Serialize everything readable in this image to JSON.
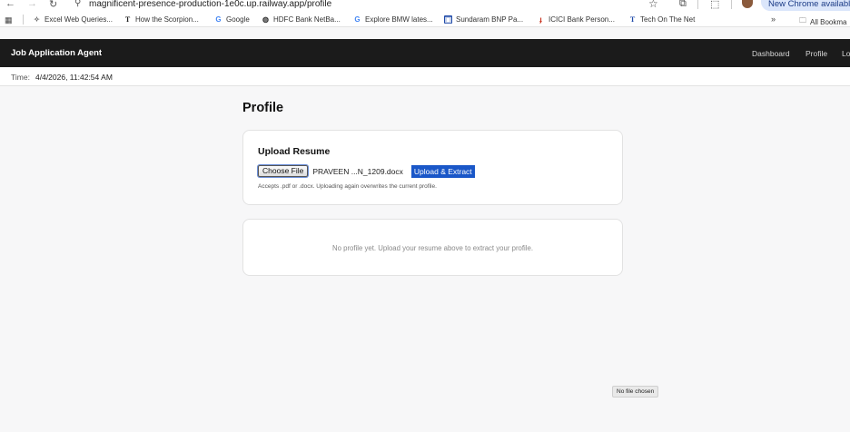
{
  "browser": {
    "url": "magnificent-presence-production-1e0c.up.railway.app/profile",
    "new_chrome_label": "New Chrome available",
    "bookmarks": [
      {
        "label": "Excel Web Queries...",
        "icon": "sparkle-icon"
      },
      {
        "label": "How the Scorpion...",
        "icon": "t-icon"
      },
      {
        "label": "Google",
        "icon": "google-icon"
      },
      {
        "label": "HDFC Bank NetBa...",
        "icon": "globe-icon"
      },
      {
        "label": "Explore BMW lates...",
        "icon": "google-icon"
      },
      {
        "label": "Sundaram BNP Pa...",
        "icon": "bank-icon"
      },
      {
        "label": "ICICI Bank Person...",
        "icon": "icici-icon"
      },
      {
        "label": "Tech On The Net",
        "icon": "t-icon"
      }
    ],
    "more_label": "»",
    "all_bookmarks_label": "All Bookma"
  },
  "app": {
    "brand": "Job Application Agent",
    "nav": [
      "Dashboard",
      "Profile",
      "Lo"
    ],
    "time_label": "Time:",
    "time_value": "4/4/2026, 11:42:54 AM"
  },
  "profile": {
    "title": "Profile",
    "upload": {
      "heading": "Upload Resume",
      "choose_label": "Choose File",
      "file_name": "PRAVEEN ...N_1209.docx",
      "submit_label": "Upload & Extract",
      "hint": "Accepts .pdf or .docx. Uploading again overwrites the current profile."
    },
    "empty_message": "No profile yet. Upload your resume above to extract your profile."
  },
  "tooltip": "No file chosen",
  "colors": {
    "header_bg": "#1b1b1b",
    "accent": "#1a57c8",
    "page_bg": "#f7f7f8"
  }
}
